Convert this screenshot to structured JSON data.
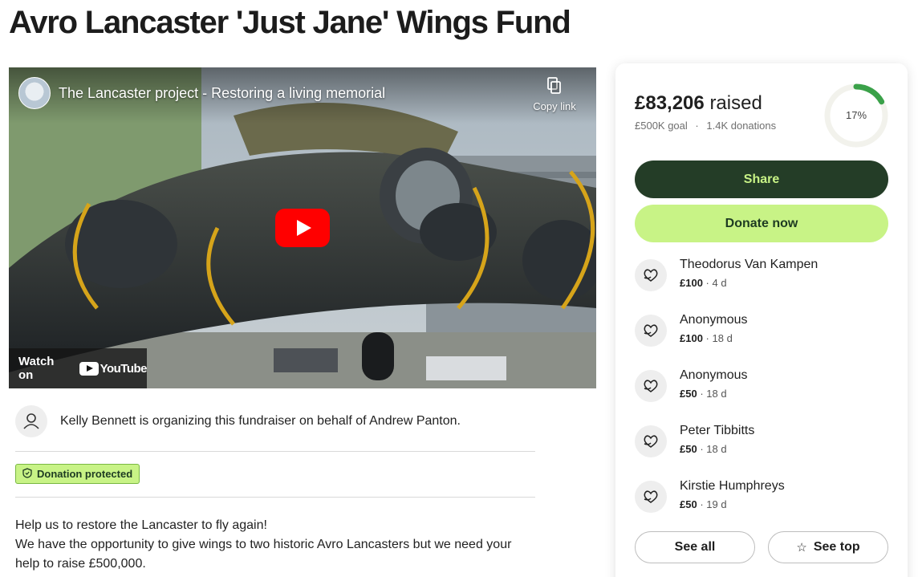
{
  "page": {
    "title": "Avro Lancaster 'Just Jane' Wings Fund"
  },
  "video": {
    "title": "The Lancaster project - Restoring a living memorial",
    "copy_link_label": "Copy link",
    "watch_on_label": "Watch on",
    "youtube_label": "YouTube"
  },
  "organizer": {
    "text": "Kelly Bennett is organizing this fundraiser on behalf of Andrew Panton."
  },
  "badge": {
    "label": "Donation protected"
  },
  "story": {
    "lines": [
      "Help us to restore the Lancaster to fly again!",
      "We have the opportunity to give wings to two historic Avro Lancasters but we need your help to raise £500,000."
    ]
  },
  "sidebar": {
    "raised_amount": "£83,206",
    "raised_word": "raised",
    "goal": "£500K goal",
    "separator": "·",
    "donation_count": "1.4K donations",
    "progress_label": "17%",
    "progress_fraction": 0.17,
    "share_label": "Share",
    "donate_label": "Donate now",
    "see_all_label": "See all",
    "see_top_label": "See top",
    "donations": [
      {
        "name": "Theodorus Van Kampen",
        "amount": "£100",
        "time": "4 d"
      },
      {
        "name": "Anonymous",
        "amount": "£100",
        "time": "18 d"
      },
      {
        "name": "Anonymous",
        "amount": "£50",
        "time": "18 d"
      },
      {
        "name": "Peter Tibbitts",
        "amount": "£50",
        "time": "18 d"
      },
      {
        "name": "Kirstie Humphreys",
        "amount": "£50",
        "time": "19 d"
      }
    ]
  },
  "colors": {
    "brand_dark": "#243d27",
    "brand_light": "#c8f386",
    "progress": "#3aa149"
  }
}
